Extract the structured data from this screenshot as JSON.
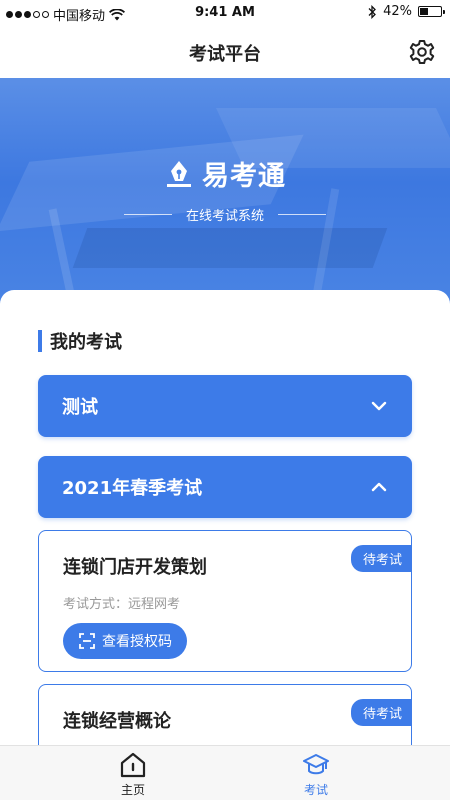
{
  "status_bar": {
    "carrier": "中国移动",
    "time": "9:41 AM",
    "battery": "42%",
    "battery_level": 0.42
  },
  "nav": {
    "title": "考试平台",
    "settings_icon": "gear-icon"
  },
  "banner": {
    "brand_name": "易考通",
    "subtitle": "在线考试系统",
    "logo_icon": "pen-logo-icon"
  },
  "section": {
    "title": "我的考试"
  },
  "groups": [
    {
      "label": "测试",
      "state": "collapsed",
      "icon": "chevron-down-icon"
    },
    {
      "label": "2021年春季考试",
      "state": "expanded",
      "icon": "chevron-up-icon"
    }
  ],
  "exams": [
    {
      "title": "连锁门店开发策划",
      "status": "待考试",
      "method": "考试方式：远程网考",
      "button": "查看授权码"
    },
    {
      "title": "连锁经营概论",
      "status": "待考试"
    }
  ],
  "tabbar": {
    "home": "主页",
    "exam": "考试"
  },
  "colors": {
    "accent": "#3d7be8",
    "banner": "#4a84e4",
    "muted_text": "#999999"
  }
}
